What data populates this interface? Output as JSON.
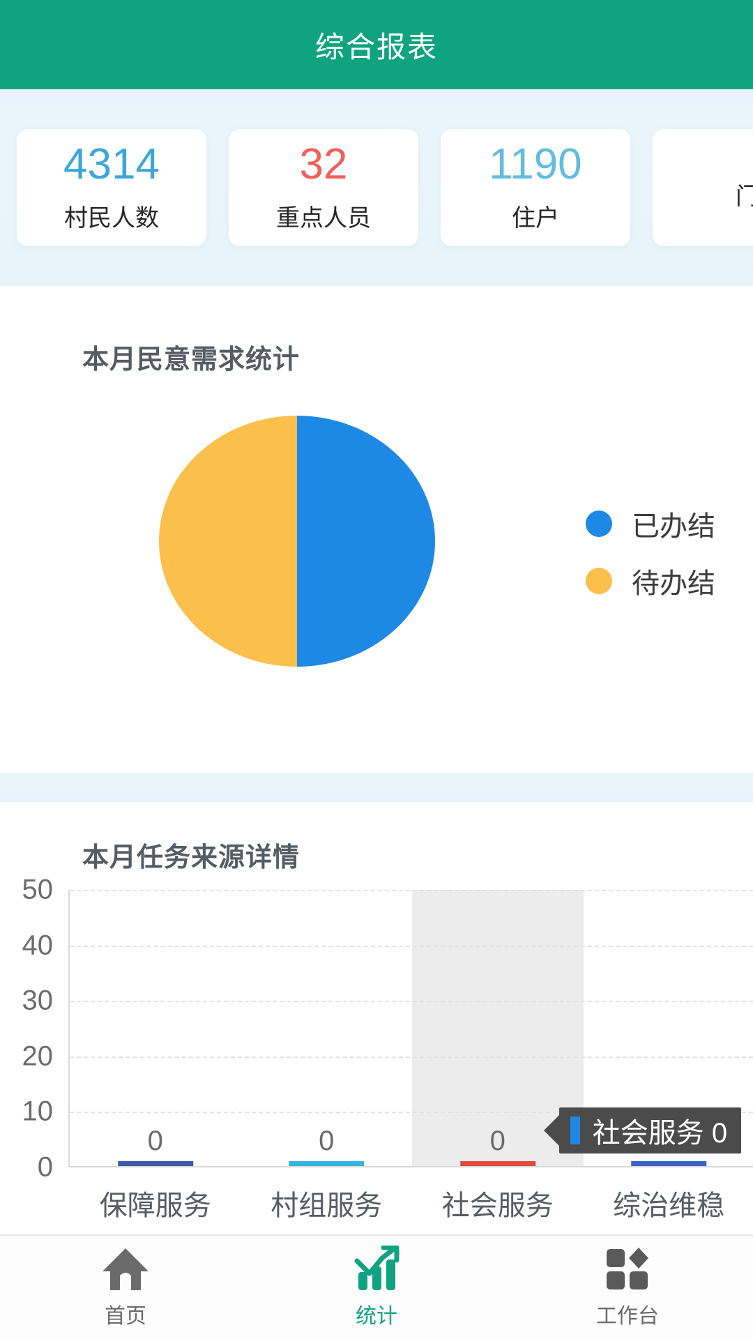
{
  "header": {
    "title": "综合报表"
  },
  "stats": {
    "cards": [
      {
        "value": "4314",
        "label": "村民人数",
        "color": "#3BA7DB"
      },
      {
        "value": "32",
        "label": "重点人员",
        "color": "#F0605B"
      },
      {
        "value": "1190",
        "label": "住户",
        "color": "#62BCE0"
      },
      {
        "value": "",
        "label": "门",
        "color": "#3BA7DB"
      }
    ]
  },
  "pie_section": {
    "title": "本月民意需求统计",
    "legend": [
      {
        "label": "已办结",
        "color": "#1E88E5"
      },
      {
        "label": "待办结",
        "color": "#FBBF4C"
      }
    ]
  },
  "bar_section": {
    "title": "本月任务来源详情",
    "tooltip": {
      "text": "社会服务 0",
      "marker_color": "#1E88E5"
    }
  },
  "bottom_nav": {
    "items": [
      {
        "label": "首页",
        "icon": "home-icon",
        "active": false
      },
      {
        "label": "统计",
        "icon": "chart-icon",
        "active": true
      },
      {
        "label": "工作台",
        "icon": "workbench-icon",
        "active": false
      }
    ]
  },
  "chart_data": [
    {
      "type": "pie",
      "title": "本月民意需求统计",
      "labels": [
        "已办结",
        "待办结"
      ],
      "values": [
        50,
        50
      ],
      "colors": [
        "#1E88E5",
        "#FBBF4C"
      ],
      "legend_position": "right",
      "grid": false
    },
    {
      "type": "bar",
      "title": "本月任务来源详情",
      "categories": [
        "保障服务",
        "村组服务",
        "社会服务",
        "综治维稳"
      ],
      "values": [
        0,
        0,
        0,
        0
      ],
      "data_labels": [
        "0",
        "0",
        "0",
        "0"
      ],
      "bar_colors": [
        "#3C5AA6",
        "#35B4E0",
        "#E04B3C",
        "#3C63C4"
      ],
      "xlabel": "",
      "ylabel": "",
      "ylim": [
        0,
        50
      ],
      "yticks": [
        0,
        10,
        20,
        30,
        40,
        50
      ],
      "ytick_labels": [
        "0",
        "10",
        "20",
        "30",
        "40",
        "50"
      ],
      "grid": true,
      "grid_style": "dashed-horizontal",
      "highlighted_category": "社会服务"
    }
  ]
}
